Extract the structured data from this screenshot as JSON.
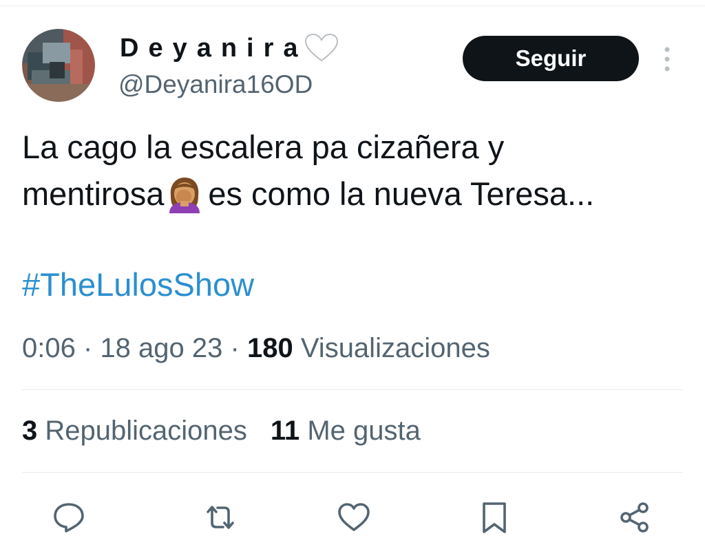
{
  "author": {
    "display_name": "Deyanira",
    "name_emoji": "white-heart-icon",
    "handle": "@Deyanira16OD",
    "avatar_icon": "avatar-photo"
  },
  "header": {
    "follow_label": "Seguir",
    "more_icon": "more-vertical-icon"
  },
  "tweet": {
    "text_line1": "La cago la escalera pa cizañera y",
    "text_line2_before_emoji": "mentirosa",
    "text_emoji": "facepalm-emoji",
    "text_line2_after_emoji": "es como la nueva Teresa...",
    "hashtag": "#TheLulosShow"
  },
  "meta": {
    "time": "0:06",
    "separator": "·",
    "date": "18 ago 23",
    "views_count": "180",
    "views_label": "Visualizaciones"
  },
  "stats": {
    "reposts_count": "3",
    "reposts_label": "Republicaciones",
    "likes_count": "11",
    "likes_label": "Me gusta"
  },
  "actions": [
    "reply-icon",
    "repost-icon",
    "like-icon",
    "bookmark-icon",
    "share-icon"
  ],
  "colors": {
    "text": "#0f1419",
    "secondary": "#536471",
    "link": "#2b8fd0",
    "button_bg": "#0f1419",
    "divider": "#e6e9ec"
  }
}
